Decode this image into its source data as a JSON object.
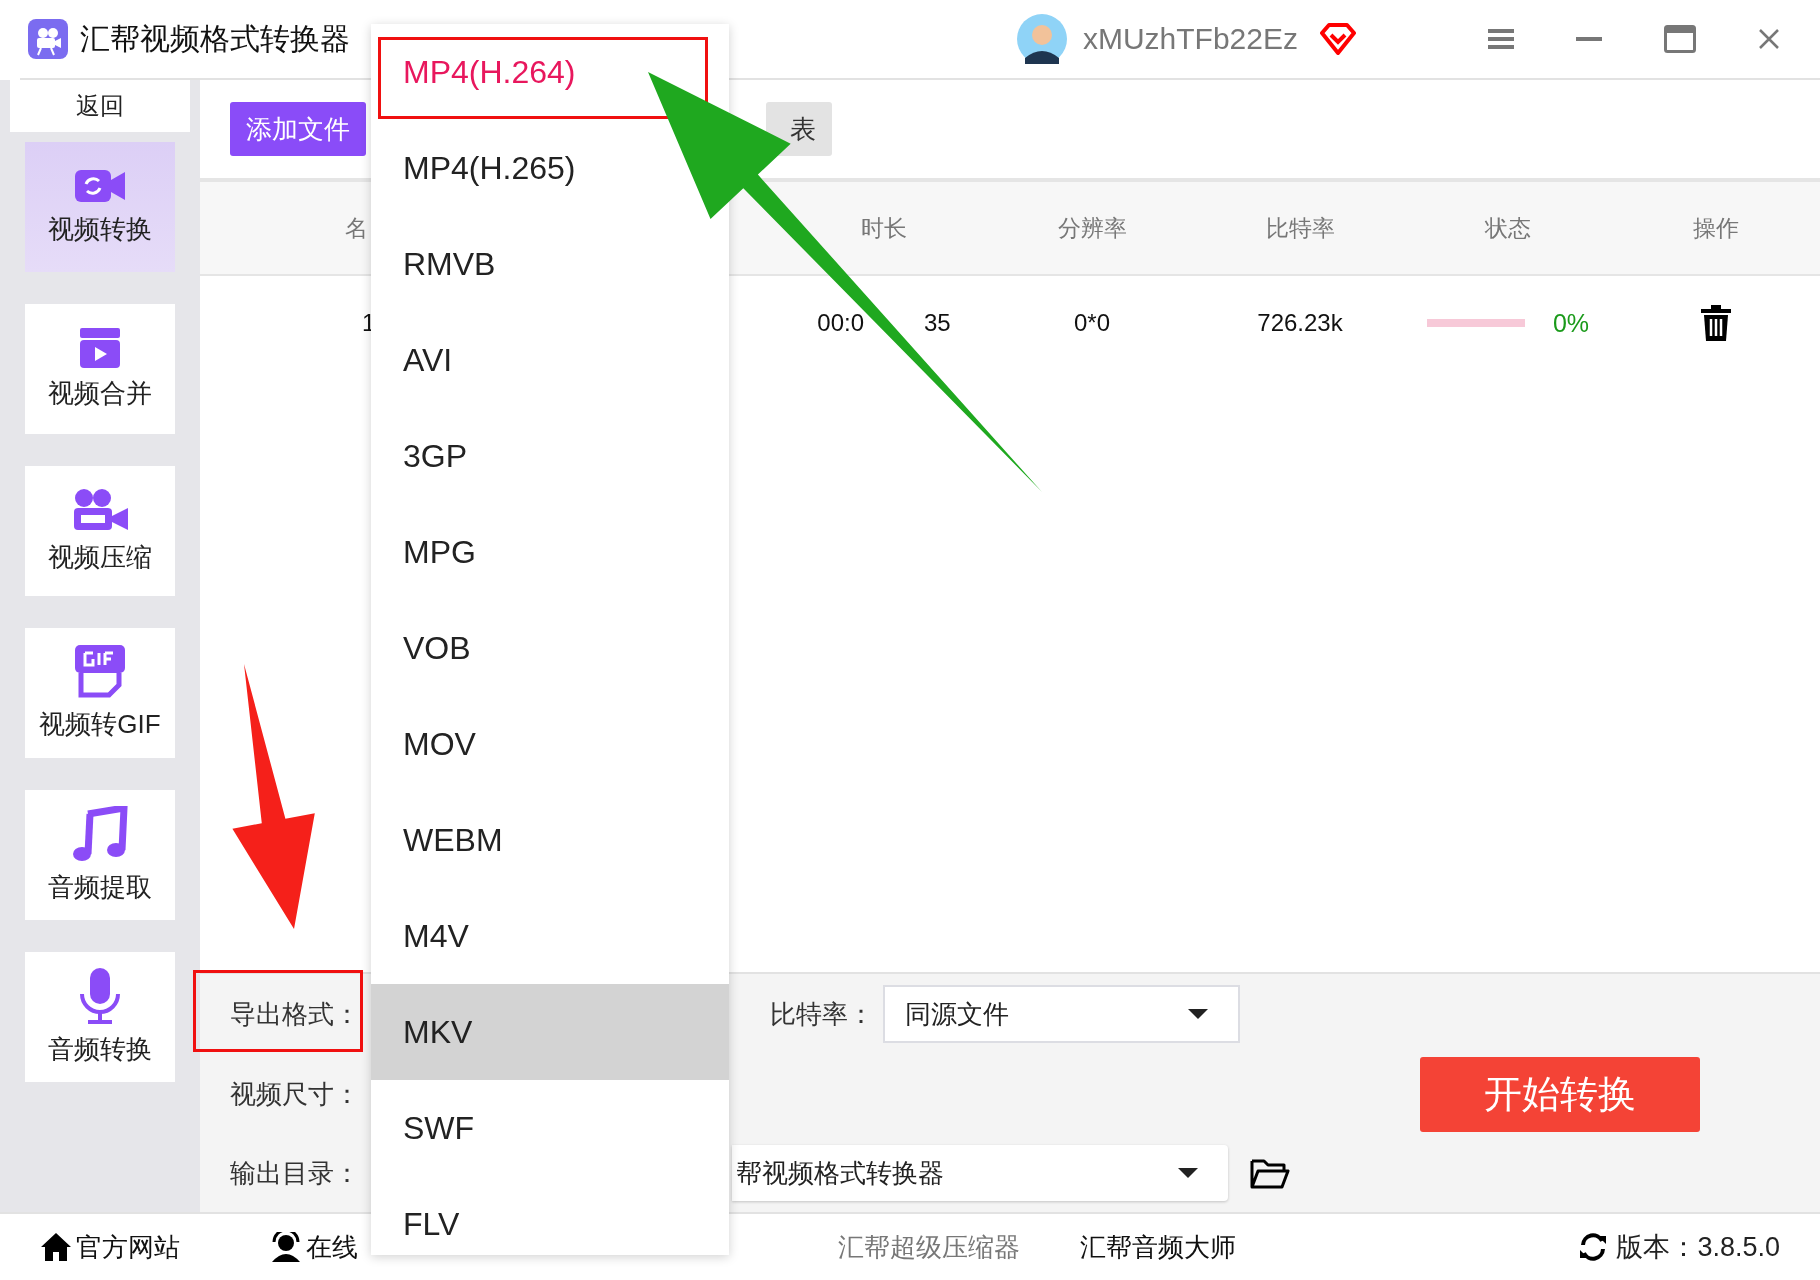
{
  "app": {
    "title": "汇帮视频格式转换器",
    "user": "xMUzhTFb22Ez"
  },
  "sidebar": {
    "back": "返回",
    "items": [
      {
        "label": "视频转换",
        "kind": "convert",
        "selected": true
      },
      {
        "label": "视频合并",
        "kind": "merge",
        "selected": false
      },
      {
        "label": "视频压缩",
        "kind": "compress",
        "selected": false
      },
      {
        "label": "视频转GIF",
        "kind": "gif",
        "selected": false
      },
      {
        "label": "音频提取",
        "kind": "extract",
        "selected": false
      },
      {
        "label": "音频转换",
        "kind": "audio",
        "selected": false
      }
    ]
  },
  "toolbar": {
    "buttons": [
      {
        "label": "添加文件",
        "kind": "primary"
      },
      {
        "label": "表",
        "kind": "secondary"
      }
    ]
  },
  "table": {
    "columns": [
      "名",
      "时长",
      "分辨率",
      "比特率",
      "状态",
      "操作"
    ],
    "rows": [
      {
        "name": "1",
        "duration_parts": [
          "00:0",
          "35"
        ],
        "resolution": "0*0",
        "bitrate": "726.23k",
        "progress": {
          "level": 0
        },
        "percent": "0%"
      }
    ]
  },
  "settings": {
    "format_label": "导出格式：",
    "size_label": "视频尺寸：",
    "output_label": "输出目录：",
    "bitrate_label": "比特率：",
    "bitrate_value": "同源文件",
    "output_value": "帮视频格式转换器",
    "start": "开始转换"
  },
  "format_menu": {
    "options": [
      {
        "label": "MP4(H.264)",
        "selected": true,
        "hovered": false
      },
      {
        "label": "MP4(H.265)",
        "selected": false,
        "hovered": false
      },
      {
        "label": "RMVB",
        "selected": false,
        "hovered": false
      },
      {
        "label": "AVI",
        "selected": false,
        "hovered": false
      },
      {
        "label": "3GP",
        "selected": false,
        "hovered": false
      },
      {
        "label": "MPG",
        "selected": false,
        "hovered": false
      },
      {
        "label": "VOB",
        "selected": false,
        "hovered": false
      },
      {
        "label": "MOV",
        "selected": false,
        "hovered": false
      },
      {
        "label": "WEBM",
        "selected": false,
        "hovered": false
      },
      {
        "label": "M4V",
        "selected": false,
        "hovered": false
      },
      {
        "label": "MKV",
        "selected": false,
        "hovered": true
      },
      {
        "label": "SWF",
        "selected": false,
        "hovered": false
      },
      {
        "label": "FLV",
        "selected": false,
        "hovered": false
      }
    ]
  },
  "footer": {
    "links": [
      {
        "label": "官方网站",
        "kind": "home"
      },
      {
        "label": "在线",
        "kind": "support"
      },
      {
        "label": "汇帮超级压缩器",
        "kind": "muted"
      },
      {
        "label": "汇帮音频大师",
        "kind": "plain"
      }
    ],
    "version": "版本：3.8.5.0"
  },
  "annotations": [
    {
      "kind": "frame_option"
    },
    {
      "kind": "frame_label"
    },
    {
      "kind": "pointer_up"
    },
    {
      "kind": "pointer_down"
    }
  ]
}
